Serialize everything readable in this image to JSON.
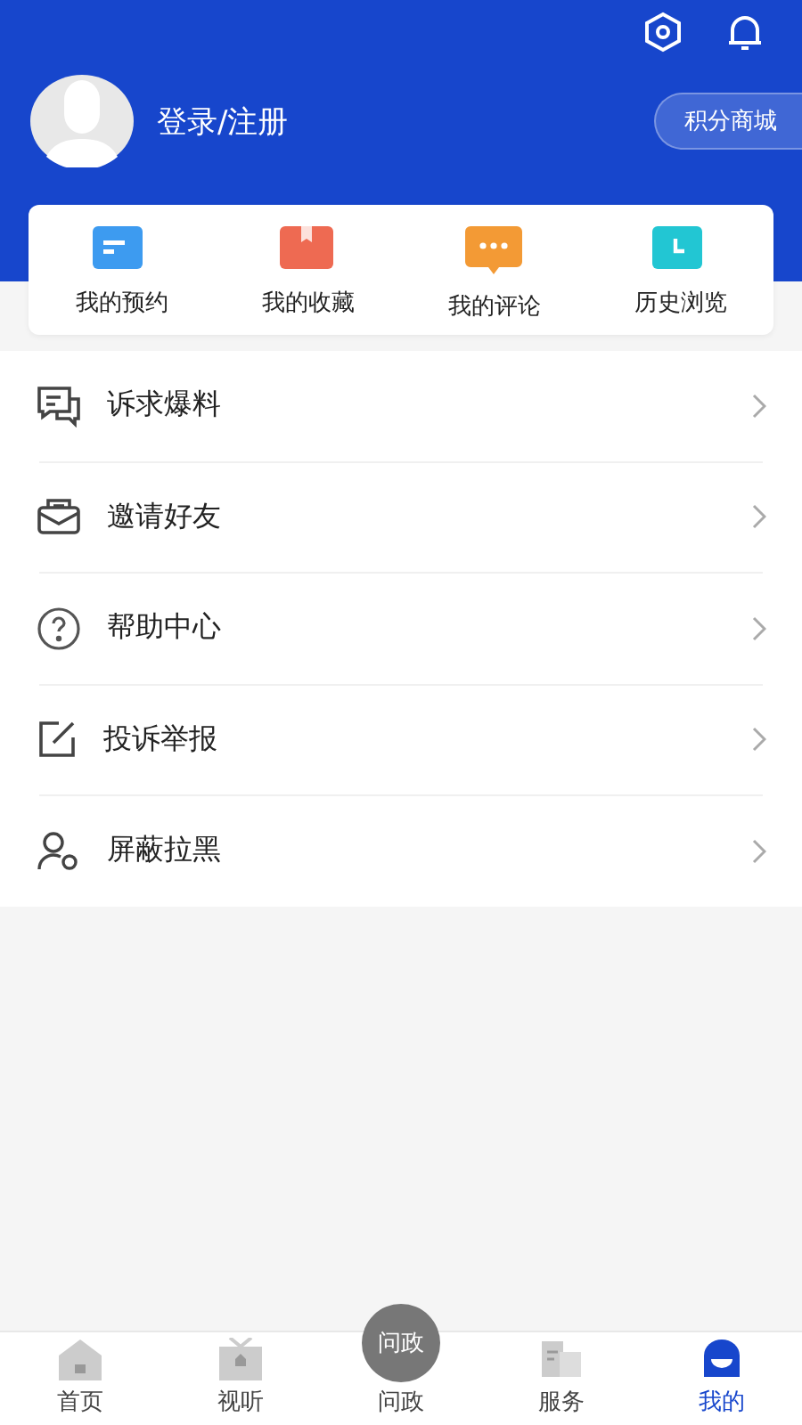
{
  "header": {
    "login": "登录/注册",
    "mall_button": "积分商城"
  },
  "shortcuts": [
    {
      "kind": "calendar",
      "label": "我的预约"
    },
    {
      "kind": "bookmark",
      "label": "我的收藏"
    },
    {
      "kind": "comment",
      "label": "我的评论"
    },
    {
      "kind": "history",
      "label": "历史浏览"
    }
  ],
  "menu": [
    {
      "kind": "report",
      "label": "诉求爆料"
    },
    {
      "kind": "invite",
      "label": "邀请好友"
    },
    {
      "kind": "help",
      "label": "帮助中心"
    },
    {
      "kind": "complaint",
      "label": "投诉举报"
    },
    {
      "kind": "block",
      "label": "屏蔽拉黑"
    }
  ],
  "tabs": [
    {
      "kind": "home",
      "label": "首页",
      "selected": false
    },
    {
      "kind": "video",
      "label": "视听",
      "selected": false
    },
    {
      "kind": "center",
      "badge": "问政",
      "label": "问政",
      "selected": false
    },
    {
      "kind": "service",
      "label": "服务",
      "selected": false
    },
    {
      "kind": "me",
      "label": "我的",
      "selected": true
    }
  ]
}
